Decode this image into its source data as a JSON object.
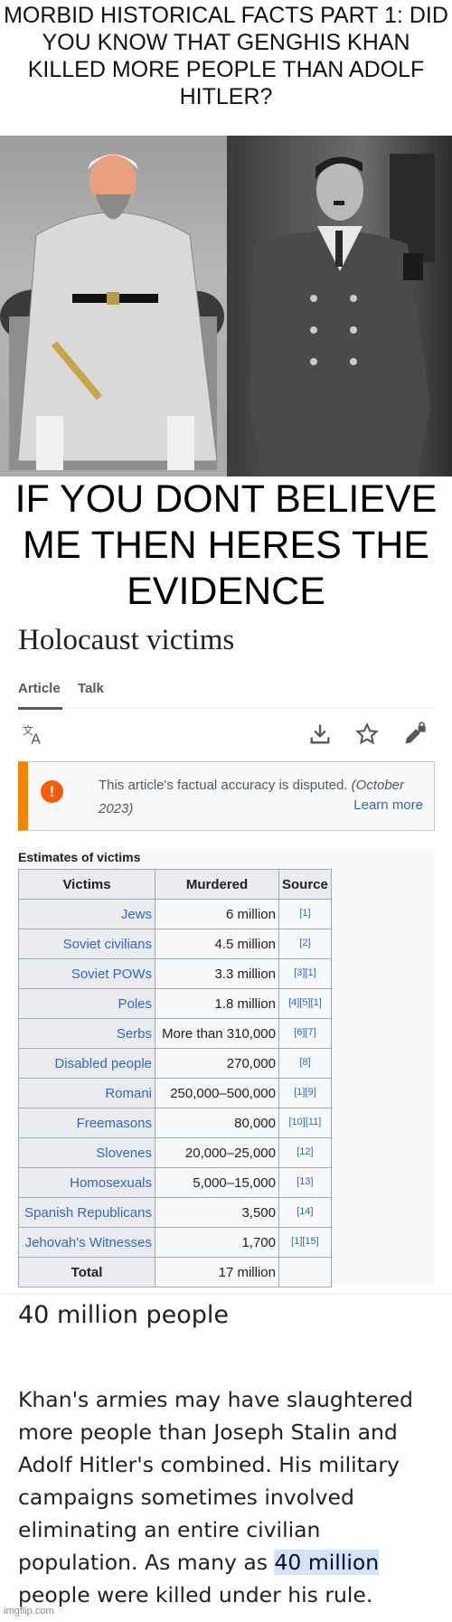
{
  "meme": {
    "top_caption": "MORBID HISTORICAL FACTS PART 1: DID YOU KNOW THAT GENGHIS KHAN KILLED MORE PEOPLE THAN ADOLF HITLER?",
    "middle_caption": "IF YOU DONT BELIEVE ME THEN HERES THE EVIDENCE",
    "images": [
      {
        "subject": "Genghis Khan portrait"
      },
      {
        "subject": "Adolf Hitler photograph"
      }
    ],
    "watermark": "imgflip.com"
  },
  "wikipedia": {
    "title": "Holocaust victims",
    "tabs": [
      {
        "label": "Article",
        "active": true
      },
      {
        "label": "Talk",
        "active": false
      }
    ],
    "icons": [
      "language-icon",
      "download-icon",
      "star-icon",
      "edit-lock-icon"
    ],
    "notice": {
      "text": "This article's factual accuracy is disputed.",
      "date": "(October 2023)",
      "link": "Learn more",
      "accent_color": "#f28500",
      "icon_color": "#fc5a03"
    },
    "table": {
      "caption": "Estimates of victims",
      "headers": [
        "Victims",
        "Murdered",
        "Source"
      ],
      "rows": [
        {
          "victims": "Jews",
          "murdered": "6 million",
          "source": "[1]"
        },
        {
          "victims": "Soviet civilians",
          "murdered": "4.5 million",
          "source": "[2]"
        },
        {
          "victims": "Soviet POWs",
          "murdered": "3.3 million",
          "source": "[3][1]"
        },
        {
          "victims": "Poles",
          "murdered": "1.8 million",
          "source": "[4][5][1]"
        },
        {
          "victims": "Serbs",
          "murdered": "More than 310,000",
          "source": "[6][7]"
        },
        {
          "victims": "Disabled people",
          "murdered": "270,000",
          "source": "[8]"
        },
        {
          "victims": "Romani",
          "murdered": "250,000–500,000",
          "source": "[1][9]"
        },
        {
          "victims": "Freemasons",
          "murdered": "80,000",
          "source": "[10][11]"
        },
        {
          "victims": "Slovenes",
          "murdered": "20,000–25,000",
          "source": "[12]"
        },
        {
          "victims": "Homosexuals",
          "murdered": "5,000–15,000",
          "source": "[13]"
        },
        {
          "victims": "Spanish Republicans",
          "murdered": "3,500",
          "source": "[14]"
        },
        {
          "victims": "Jehovah's Witnesses",
          "murdered": "1,700",
          "source": "[1][15]"
        }
      ],
      "total": {
        "label": "Total",
        "murdered": "17 million",
        "source": ""
      },
      "link_color": "#3366cc"
    }
  },
  "google": {
    "answer": "40 million people",
    "snippet_before": "Khan's armies may have slaughtered more people than Joseph Stalin and Adolf Hitler's combined. His military campaigns sometimes involved eliminating an entire civilian population. As many as ",
    "snippet_highlight": "40 million",
    "snippet_after": " people were killed under his rule.",
    "highlight_color": "#d3e3fd"
  }
}
